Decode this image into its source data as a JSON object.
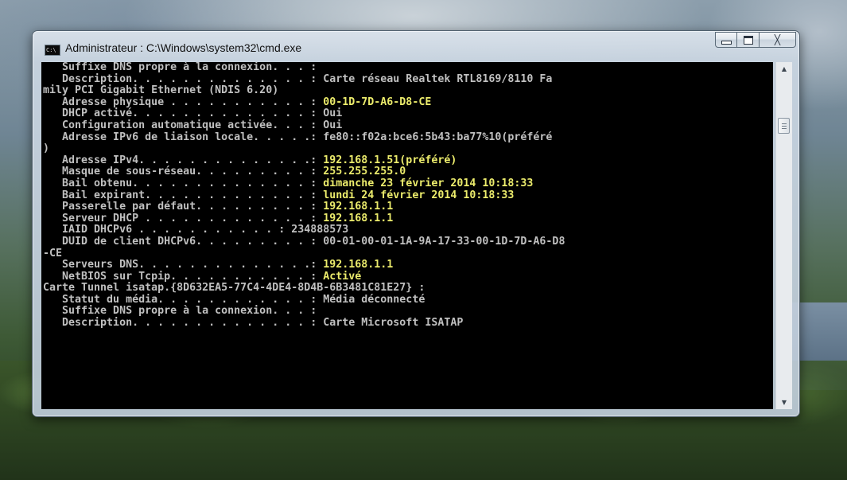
{
  "window": {
    "title": "Administrateur : C:\\Windows\\system32\\cmd.exe",
    "icon": "cmd-icon",
    "icon_text": "C:\\",
    "buttons": {
      "minimize": "minimize-icon",
      "maximize": "maximize-icon",
      "close": "╳"
    }
  },
  "colors": {
    "text": "#c0c0c0",
    "highlight": "#ecec6c",
    "background": "#000000"
  },
  "console": {
    "lines": [
      {
        "label": "   Suffixe DNS propre à la connexion. . . :",
        "value": ""
      },
      {
        "label": "   Description. . . . . . . . . . . . . . :",
        "value": " Carte réseau Realtek RTL8169/8110 Fa"
      },
      {
        "label": "mily PCI Gigabit Ethernet (NDIS 6.20)",
        "value": ""
      },
      {
        "label": "   Adresse physique . . . . . . . . . . . :",
        "value": " 00-1D-7D-A6-D8-CE",
        "hl": true
      },
      {
        "label": "   DHCP activé. . . . . . . . . . . . . . :",
        "value": " Oui"
      },
      {
        "label": "   Configuration automatique activée. . . :",
        "value": " Oui"
      },
      {
        "label": "   Adresse IPv6 de liaison locale. . . . .:",
        "value": " fe80::f02a:bce6:5b43:ba77%10(préféré"
      },
      {
        "label": ")",
        "value": ""
      },
      {
        "label": "   Adresse IPv4. . . . . . . . . . . . . .:",
        "value": " 192.168.1.51(préféré)",
        "hl": true
      },
      {
        "label": "   Masque de sous-réseau. . . . . . . . . :",
        "value": " 255.255.255.0",
        "hl": true
      },
      {
        "label": "   Bail obtenu. . . . . . . . . . . . . . :",
        "value": " dimanche 23 février 2014 10:18:33",
        "hl": true
      },
      {
        "label": "   Bail expirant. . . . . . . . . . . . . :",
        "value": " lundi 24 février 2014 10:18:33",
        "hl": true
      },
      {
        "label": "   Passerelle par défaut. . . . . . . . . :",
        "value": " 192.168.1.1",
        "hl": true
      },
      {
        "label": "   Serveur DHCP . . . . . . . . . . . . . :",
        "value": " 192.168.1.1",
        "hl": true
      },
      {
        "label": "   IAID DHCPv6 . . . . . . . . . . . :",
        "value": " 234888573"
      },
      {
        "label": "   DUID de client DHCPv6. . . . . . . . . :",
        "value": " 00-01-00-01-1A-9A-17-33-00-1D-7D-A6-D8"
      },
      {
        "label": "-CE",
        "value": ""
      },
      {
        "label": "   Serveurs DNS. . . . . . . . . . . . . .:",
        "value": " 192.168.1.1",
        "hl": true
      },
      {
        "label": "   NetBIOS sur Tcpip. . . . . . . . . . . :",
        "value": " Activé",
        "hl": true
      },
      {
        "label": "",
        "value": ""
      },
      {
        "label": "Carte Tunnel isatap.{8D632EA5-77C4-4DE4-8D4B-6B3481C81E27} :",
        "value": ""
      },
      {
        "label": "",
        "value": ""
      },
      {
        "label": "   Statut du média. . . . . . . . . . . . :",
        "value": " Média déconnecté"
      },
      {
        "label": "   Suffixe DNS propre à la connexion. . . :",
        "value": ""
      },
      {
        "label": "   Description. . . . . . . . . . . . . . :",
        "value": " Carte Microsoft ISATAP"
      }
    ]
  },
  "scrollbar": {
    "up": "▲",
    "down": "▼",
    "position": 0.14
  }
}
